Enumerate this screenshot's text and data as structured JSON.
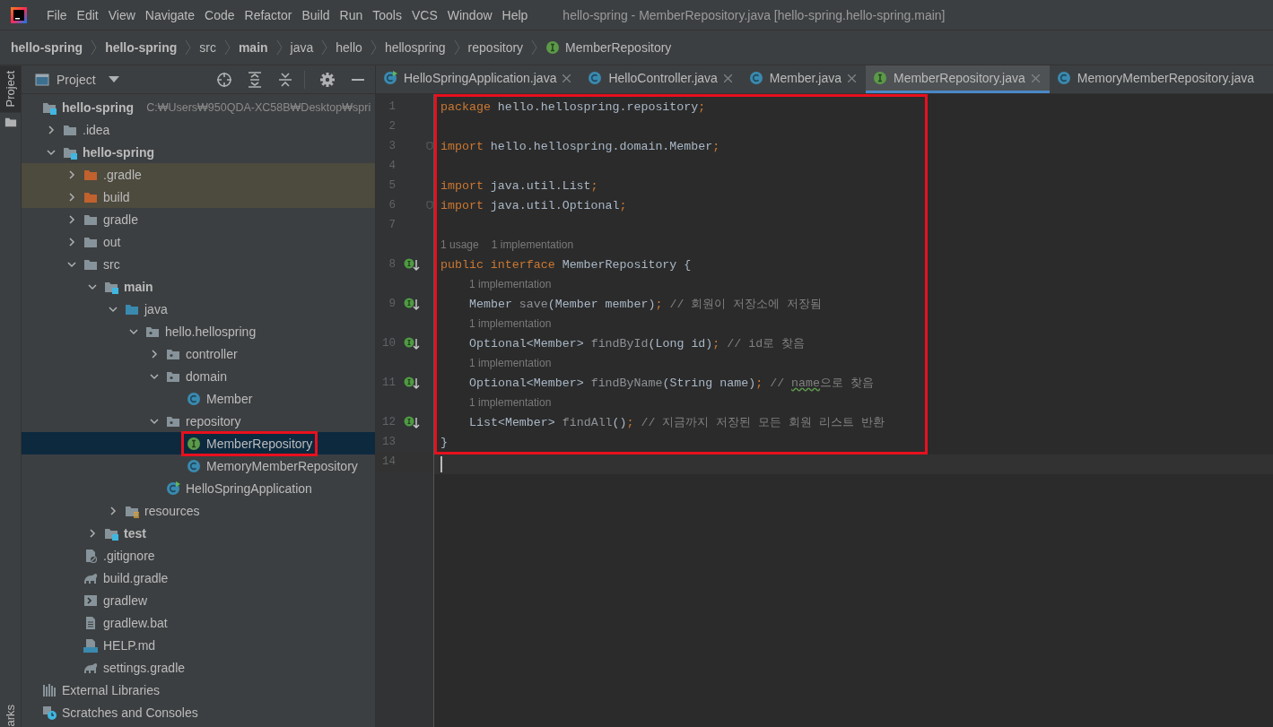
{
  "menu_bar": {
    "items": [
      "File",
      "Edit",
      "View",
      "Navigate",
      "Code",
      "Refactor",
      "Build",
      "Run",
      "Tools",
      "VCS",
      "Window",
      "Help"
    ],
    "title": "hello-spring - MemberRepository.java [hello-spring.hello-spring.main]"
  },
  "breadcrumbs": [
    {
      "label": "hello-spring",
      "bold": true
    },
    {
      "label": "hello-spring",
      "bold": true
    },
    {
      "label": "src",
      "bold": false
    },
    {
      "label": "main",
      "bold": true
    },
    {
      "label": "java",
      "bold": false
    },
    {
      "label": "hello",
      "bold": false
    },
    {
      "label": "hellospring",
      "bold": false
    },
    {
      "label": "repository",
      "bold": false
    },
    {
      "label": "MemberRepository",
      "bold": false,
      "kind": "interface"
    }
  ],
  "tool_stripe": {
    "top_tab": {
      "label": "Project",
      "selected": true
    },
    "bottom_tab": "arks"
  },
  "project_panel": {
    "title": "Project",
    "tree": [
      {
        "label": "hello-spring",
        "kind": "module",
        "bold": true,
        "path": "C:₩Users₩950QDA-XC58B₩Desktop₩spri",
        "children": [
          {
            "label": ".idea",
            "kind": "folder",
            "expanded": false
          },
          {
            "label": "hello-spring",
            "kind": "module",
            "bold": true,
            "expanded": true,
            "children": [
              {
                "label": ".gradle",
                "kind": "excluded",
                "expanded": false,
                "excluded": true
              },
              {
                "label": "build",
                "kind": "excluded",
                "expanded": false,
                "excluded": true
              },
              {
                "label": "gradle",
                "kind": "folder",
                "expanded": false
              },
              {
                "label": "out",
                "kind": "folder",
                "expanded": false
              },
              {
                "label": "src",
                "kind": "folder",
                "expanded": true,
                "children": [
                  {
                    "label": "main",
                    "kind": "module",
                    "bold": true,
                    "expanded": true,
                    "children": [
                      {
                        "label": "java",
                        "kind": "source",
                        "expanded": true,
                        "children": [
                          {
                            "label": "hello.hellospring",
                            "kind": "package",
                            "expanded": true,
                            "children": [
                              {
                                "label": "controller",
                                "kind": "package",
                                "expanded": false
                              },
                              {
                                "label": "domain",
                                "kind": "package",
                                "expanded": true,
                                "children": [
                                  {
                                    "label": "Member",
                                    "kind": "class"
                                  }
                                ]
                              },
                              {
                                "label": "repository",
                                "kind": "package",
                                "expanded": true,
                                "children": [
                                  {
                                    "label": "MemberRepository",
                                    "kind": "interface",
                                    "selected": true,
                                    "highlighted": true
                                  },
                                  {
                                    "label": "MemoryMemberRepository",
                                    "kind": "class",
                                    "selected": false,
                                    "highlighted": false
                                  }
                                ]
                              },
                              {
                                "label": "HelloSpringApplication",
                                "kind": "spring"
                              }
                            ]
                          }
                        ]
                      },
                      {
                        "label": "resources",
                        "kind": "resources",
                        "expanded": false
                      }
                    ]
                  },
                  {
                    "label": "test",
                    "kind": "module",
                    "bold": true,
                    "expanded": false
                  }
                ]
              },
              {
                "label": ".gitignore",
                "kind": "ignore"
              },
              {
                "label": "build.gradle",
                "kind": "gradle"
              },
              {
                "label": "gradlew",
                "kind": "script"
              },
              {
                "label": "gradlew.bat",
                "kind": "text"
              },
              {
                "label": "HELP.md",
                "kind": "markdown"
              },
              {
                "label": "settings.gradle",
                "kind": "gradle"
              }
            ]
          }
        ]
      },
      {
        "label": "External Libraries",
        "kind": "libraries"
      },
      {
        "label": "Scratches and Consoles",
        "kind": "scratches"
      }
    ]
  },
  "editor_tabs": [
    {
      "label": "HelloSpringApplication.java",
      "kind": "spring",
      "selected": false,
      "closable": true
    },
    {
      "label": "HelloController.java",
      "kind": "class",
      "selected": false,
      "closable": true
    },
    {
      "label": "Member.java",
      "kind": "class",
      "selected": false,
      "closable": true
    },
    {
      "label": "MemberRepository.java",
      "kind": "interface",
      "selected": true,
      "closable": true
    },
    {
      "label": "MemoryMemberRepository.java",
      "kind": "class",
      "selected": false,
      "closable": false
    }
  ],
  "editor": {
    "lines": [
      {
        "number": "1",
        "highlighted": true,
        "tokens": [
          {
            "kind": "keyword",
            "text": "package "
          },
          {
            "kind": "plain",
            "text": "hello.hellospring.repository"
          },
          {
            "kind": "punct",
            "text": ";"
          }
        ]
      },
      {
        "number": "2",
        "highlighted": true
      },
      {
        "number": "3",
        "highlighted": true,
        "fold": true,
        "tokens": [
          {
            "kind": "keyword",
            "text": "import "
          },
          {
            "kind": "plain",
            "text": "hello.hellospring.domain.Member"
          },
          {
            "kind": "punct",
            "text": ";"
          }
        ]
      },
      {
        "number": "4",
        "highlighted": true
      },
      {
        "number": "5",
        "highlighted": true,
        "tokens": [
          {
            "kind": "keyword",
            "text": "import "
          },
          {
            "kind": "plain",
            "text": "java.util.List"
          },
          {
            "kind": "punct",
            "text": ";"
          }
        ]
      },
      {
        "number": "6",
        "highlighted": true,
        "fold": true,
        "tokens": [
          {
            "kind": "keyword",
            "text": "import "
          },
          {
            "kind": "plain",
            "text": "java.util.Optional"
          },
          {
            "kind": "punct",
            "text": ";"
          }
        ]
      },
      {
        "number": "7",
        "highlighted": true
      },
      {
        "number": "8",
        "highlighted": true,
        "implemented": true,
        "indented": false,
        "hints": [
          "1 usage",
          "1 implementation"
        ],
        "tokens": [
          {
            "kind": "keyword",
            "text": "public interface "
          },
          {
            "kind": "plain",
            "text": "MemberRepository {"
          }
        ]
      },
      {
        "number": "9",
        "highlighted": true,
        "implemented": true,
        "indented": true,
        "hints": [
          "1 implementation"
        ],
        "tokens": [
          {
            "kind": "plain",
            "text": "Member "
          },
          {
            "kind": "method",
            "text": "save"
          },
          {
            "kind": "plain",
            "text": "(Member member)"
          },
          {
            "kind": "punct",
            "text": ";"
          },
          {
            "kind": "comment",
            "text": " // 회원이 저장소에 저장됨"
          }
        ]
      },
      {
        "number": "10",
        "highlighted": true,
        "implemented": true,
        "indented": true,
        "hints": [
          "1 implementation"
        ],
        "tokens": [
          {
            "kind": "plain",
            "text": "Optional<Member> "
          },
          {
            "kind": "method",
            "text": "findById"
          },
          {
            "kind": "plain",
            "text": "(Long id)"
          },
          {
            "kind": "punct",
            "text": ";"
          },
          {
            "kind": "comment",
            "text": " // id로 찾음"
          }
        ]
      },
      {
        "number": "11",
        "highlighted": true,
        "implemented": true,
        "indented": true,
        "hints": [
          "1 implementation"
        ],
        "tokens": [
          {
            "kind": "plain",
            "text": "Optional<Member> "
          },
          {
            "kind": "method",
            "text": "findByName"
          },
          {
            "kind": "plain",
            "text": "(String name)"
          },
          {
            "kind": "punct",
            "text": ";"
          },
          {
            "kind": "comment",
            "text": " // "
          },
          {
            "kind": "typo",
            "text": "name"
          },
          {
            "kind": "comment",
            "text": "으로 찾음"
          }
        ]
      },
      {
        "number": "12",
        "highlighted": true,
        "implemented": true,
        "indented": true,
        "hints": [
          "1 implementation"
        ],
        "tokens": [
          {
            "kind": "plain",
            "text": "List<Member> "
          },
          {
            "kind": "method",
            "text": "findAll"
          },
          {
            "kind": "plain",
            "text": "()"
          },
          {
            "kind": "punct",
            "text": ";"
          },
          {
            "kind": "comment",
            "text": " // 지금까지 저장된 모든 회원 리스트 반환"
          }
        ]
      },
      {
        "number": "13",
        "highlighted": true,
        "tokens": [
          {
            "kind": "plain",
            "text": "}"
          }
        ]
      },
      {
        "number": "14",
        "highlighted": false,
        "caret": true
      }
    ]
  }
}
